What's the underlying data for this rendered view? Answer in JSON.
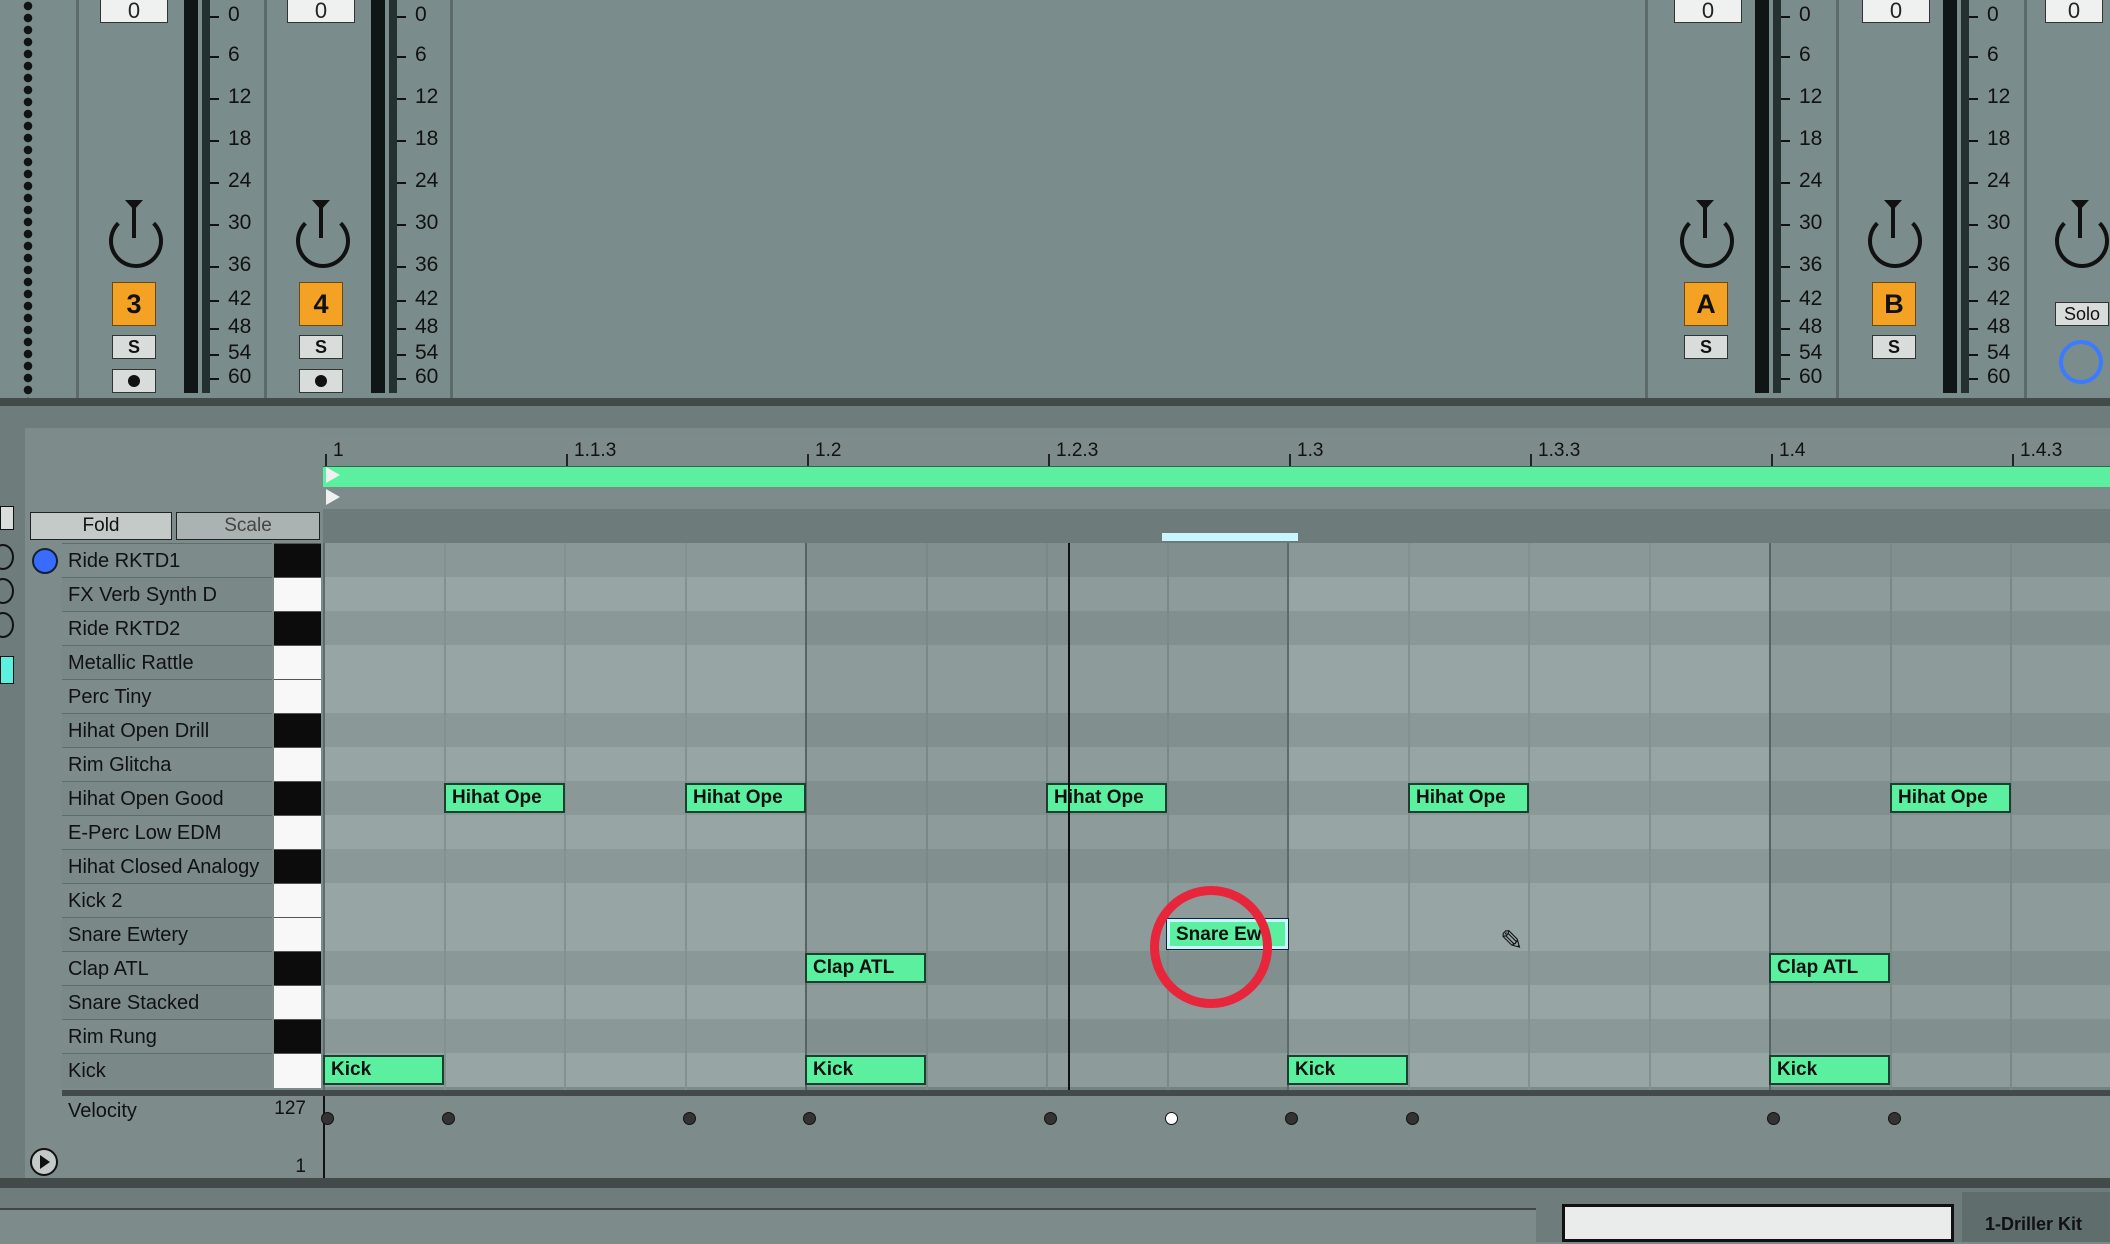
{
  "mixer": {
    "strips": [
      {
        "id": "3",
        "volume": "0",
        "track_label": "3",
        "solo_label": "S"
      },
      {
        "id": "4",
        "volume": "0",
        "track_label": "4",
        "solo_label": "S"
      },
      {
        "id": "A",
        "volume": "0",
        "track_label": "A",
        "solo_label": "S"
      },
      {
        "id": "B",
        "volume": "0",
        "track_label": "B",
        "solo_label": "S"
      },
      {
        "id": "M",
        "volume": "0",
        "solo_label": "Solo"
      }
    ],
    "scale_ticks": [
      "0",
      "6",
      "12",
      "18",
      "24",
      "30",
      "36",
      "42",
      "48",
      "54",
      "60"
    ]
  },
  "ruler": {
    "marks": [
      "1",
      "1.1.3",
      "1.2",
      "1.2.3",
      "1.3",
      "1.3.3",
      "1.4",
      "1.4.3"
    ]
  },
  "header": {
    "fold_label": "Fold",
    "scale_label": "Scale"
  },
  "drum_rows": [
    {
      "name": "Ride RKTD1",
      "key": "black"
    },
    {
      "name": "FX Verb Synth D",
      "key": "white"
    },
    {
      "name": "Ride RKTD2",
      "key": "black"
    },
    {
      "name": "Metallic Rattle",
      "key": "white"
    },
    {
      "name": "Perc Tiny",
      "key": "white"
    },
    {
      "name": "Hihat Open Drill",
      "key": "black"
    },
    {
      "name": "Rim Glitcha",
      "key": "white"
    },
    {
      "name": "Hihat Open Good",
      "key": "black"
    },
    {
      "name": "E-Perc Low EDM",
      "key": "white"
    },
    {
      "name": "Hihat Closed Analogy",
      "key": "black"
    },
    {
      "name": "Kick 2",
      "key": "white"
    },
    {
      "name": "Snare Ewtery",
      "key": "white"
    },
    {
      "name": "Clap ATL",
      "key": "black"
    },
    {
      "name": "Snare Stacked",
      "key": "white"
    },
    {
      "name": "Rim Rung",
      "key": "black"
    },
    {
      "name": "Kick",
      "key": "white"
    }
  ],
  "notes": [
    {
      "label": "Hihat Ope",
      "row": 7,
      "col": 1
    },
    {
      "label": "Hihat Ope",
      "row": 7,
      "col": 3
    },
    {
      "label": "Hihat Ope",
      "row": 7,
      "col": 6
    },
    {
      "label": "Hihat Ope",
      "row": 7,
      "col": 9
    },
    {
      "label": "Hihat Ope",
      "row": 7,
      "col": 13
    },
    {
      "label": "Snare Ewt",
      "row": 11,
      "col": 7
    },
    {
      "label": "Clap ATL",
      "row": 12,
      "col": 4
    },
    {
      "label": "Clap ATL",
      "row": 12,
      "col": 12
    },
    {
      "label": "Kick",
      "row": 15,
      "col": 0
    },
    {
      "label": "Kick",
      "row": 15,
      "col": 4
    },
    {
      "label": "Kick",
      "row": 15,
      "col": 8
    },
    {
      "label": "Kick",
      "row": 15,
      "col": 12
    }
  ],
  "velocity": {
    "label": "Velocity",
    "max": "127",
    "min": "1"
  },
  "bottom": {
    "device_label": "1-Driller Kit"
  },
  "colors": {
    "note": "#5bf0a0",
    "accent_orange": "#f4a223",
    "highlight_ring": "#e8263b",
    "selection": "#c8f5ff"
  }
}
